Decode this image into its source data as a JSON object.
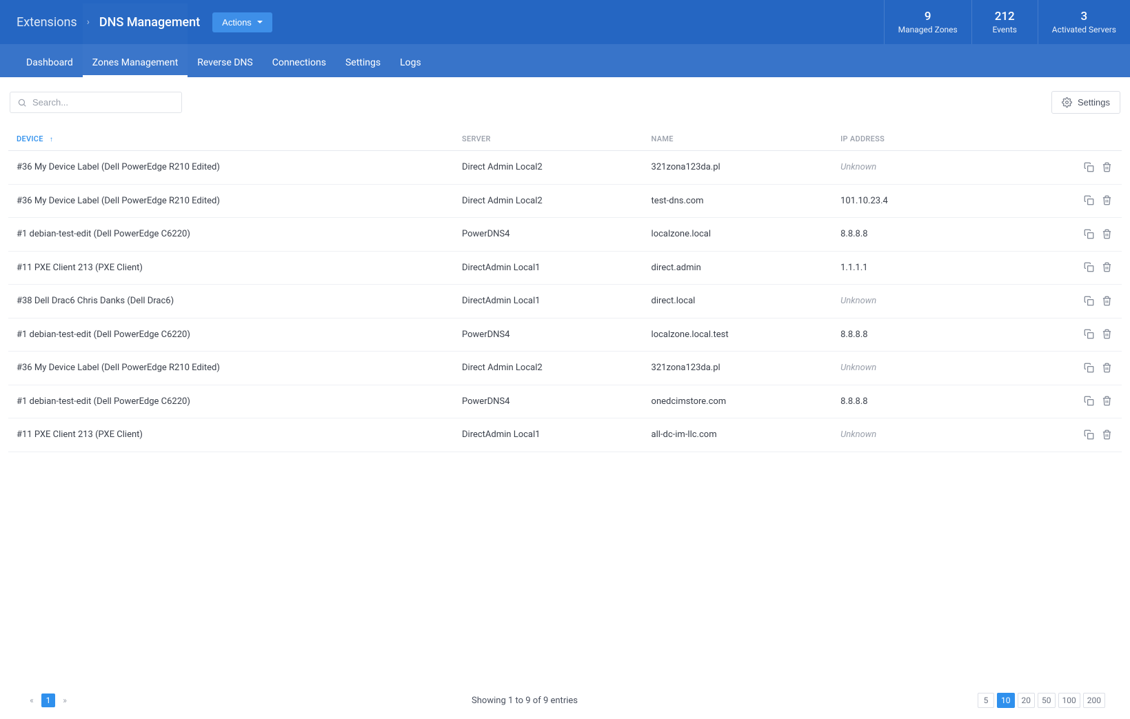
{
  "breadcrumb": {
    "root": "Extensions",
    "current": "DNS Management"
  },
  "actions_button": "Actions",
  "stats": [
    {
      "value": "9",
      "label": "Managed Zones"
    },
    {
      "value": "212",
      "label": "Events"
    },
    {
      "value": "3",
      "label": "Activated Servers"
    }
  ],
  "tabs": [
    {
      "label": "Dashboard",
      "active": false
    },
    {
      "label": "Zones Management",
      "active": true
    },
    {
      "label": "Reverse DNS",
      "active": false
    },
    {
      "label": "Connections",
      "active": false
    },
    {
      "label": "Settings",
      "active": false
    },
    {
      "label": "Logs",
      "active": false
    }
  ],
  "search": {
    "placeholder": "Search..."
  },
  "settings_button": "Settings",
  "table": {
    "columns": {
      "device": "DEVICE",
      "server": "SERVER",
      "name": "NAME",
      "ip": "IP ADDRESS"
    },
    "sort": {
      "column": "device",
      "direction": "asc",
      "arrow": "↑"
    },
    "unknown_label": "Unknown",
    "rows": [
      {
        "device": "#36 My Device Label (Dell PowerEdge R210 Edited)",
        "server": "Direct Admin Local2",
        "name": "321zona123da.pl",
        "ip": null
      },
      {
        "device": "#36 My Device Label (Dell PowerEdge R210 Edited)",
        "server": "Direct Admin Local2",
        "name": "test-dns.com",
        "ip": "101.10.23.4"
      },
      {
        "device": "#1 debian-test-edit (Dell PowerEdge C6220)",
        "server": "PowerDNS4",
        "name": "localzone.local",
        "ip": "8.8.8.8"
      },
      {
        "device": "#11 PXE Client 213 (PXE Client)",
        "server": "DirectAdmin Local1",
        "name": "direct.admin",
        "ip": "1.1.1.1"
      },
      {
        "device": "#38 Dell Drac6 Chris Danks (Dell Drac6)",
        "server": "DirectAdmin Local1",
        "name": "direct.local",
        "ip": null
      },
      {
        "device": "#1 debian-test-edit (Dell PowerEdge C6220)",
        "server": "PowerDNS4",
        "name": "localzone.local.test",
        "ip": "8.8.8.8"
      },
      {
        "device": "#36 My Device Label (Dell PowerEdge R210 Edited)",
        "server": "Direct Admin Local2",
        "name": "321zona123da.pl",
        "ip": null
      },
      {
        "device": "#1 debian-test-edit (Dell PowerEdge C6220)",
        "server": "PowerDNS4",
        "name": "onedcimstore.com",
        "ip": "8.8.8.8"
      },
      {
        "device": "#11 PXE Client 213 (PXE Client)",
        "server": "DirectAdmin Local1",
        "name": "all-dc-im-llc.com",
        "ip": null
      }
    ]
  },
  "pagination": {
    "current_page": "1",
    "summary": "Showing 1 to 9 of 9 entries",
    "page_sizes": [
      "5",
      "10",
      "20",
      "50",
      "100",
      "200"
    ],
    "active_size": "10"
  }
}
